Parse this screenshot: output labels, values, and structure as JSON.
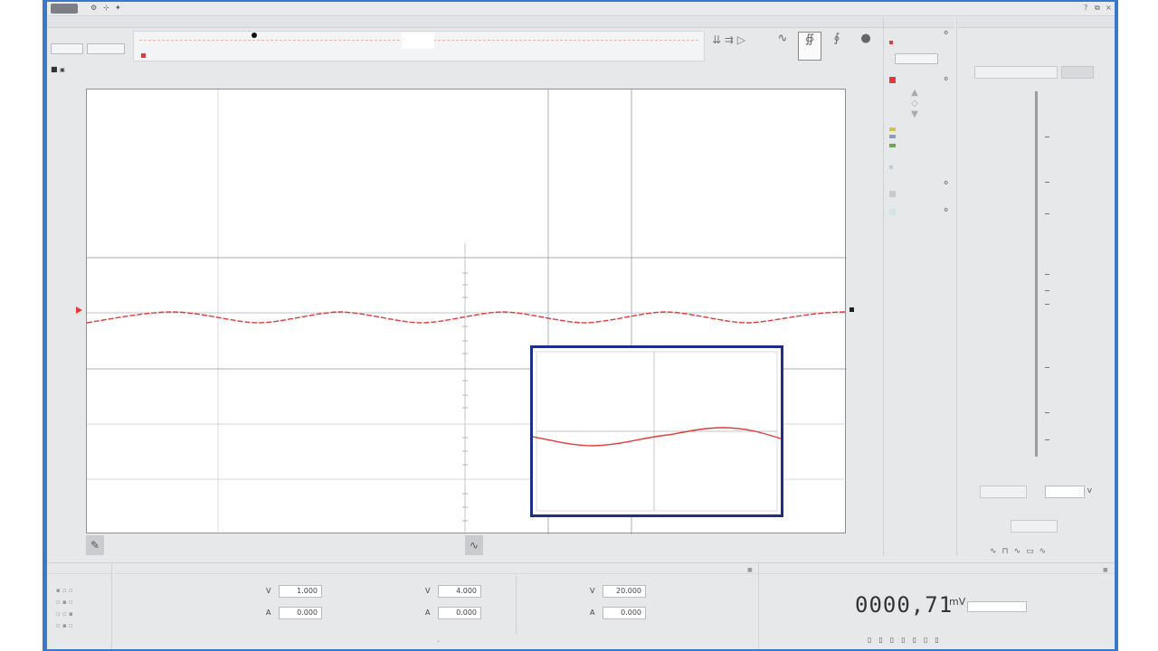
{
  "titlebar": {
    "start_label": "",
    "app_title": "",
    "brand": ""
  },
  "panels": {
    "scope_title": "",
    "autorange_title": "",
    "trigger_title": ""
  },
  "toolbar": {
    "zoom_label": "",
    "zoom_buttons": [
      "",
      ""
    ],
    "channel_label": "",
    "timeline_right": "",
    "acquisition_label": "",
    "modes": [
      {
        "label": "",
        "glyph": "∿"
      },
      {
        "label": "",
        "glyph": "∯"
      },
      {
        "label": "",
        "glyph": "∮"
      },
      {
        "label": "",
        "glyph": "●"
      }
    ]
  },
  "plot": {
    "trace_color": "#e53935",
    "grid_color": "#c8cacd",
    "trigger_level_label": "",
    "channel_marker_label": ""
  },
  "bottom": {
    "counter_title": "",
    "measure_title": "",
    "rows": [
      {
        "v_value": "1.000",
        "a_value": "0.000"
      },
      {
        "v_value": "4.000",
        "a_value": "0.000"
      },
      {
        "v_value": "20.000",
        "a_value": "0.000"
      }
    ],
    "row_unit_v": "V",
    "row_unit_a": "A",
    "display_title": "",
    "readout_value": "0000,71",
    "readout_unit": "mV"
  },
  "autorange": {
    "top_value": "",
    "field_value": "",
    "field_unit": "V",
    "labels": [
      "",
      ""
    ]
  }
}
